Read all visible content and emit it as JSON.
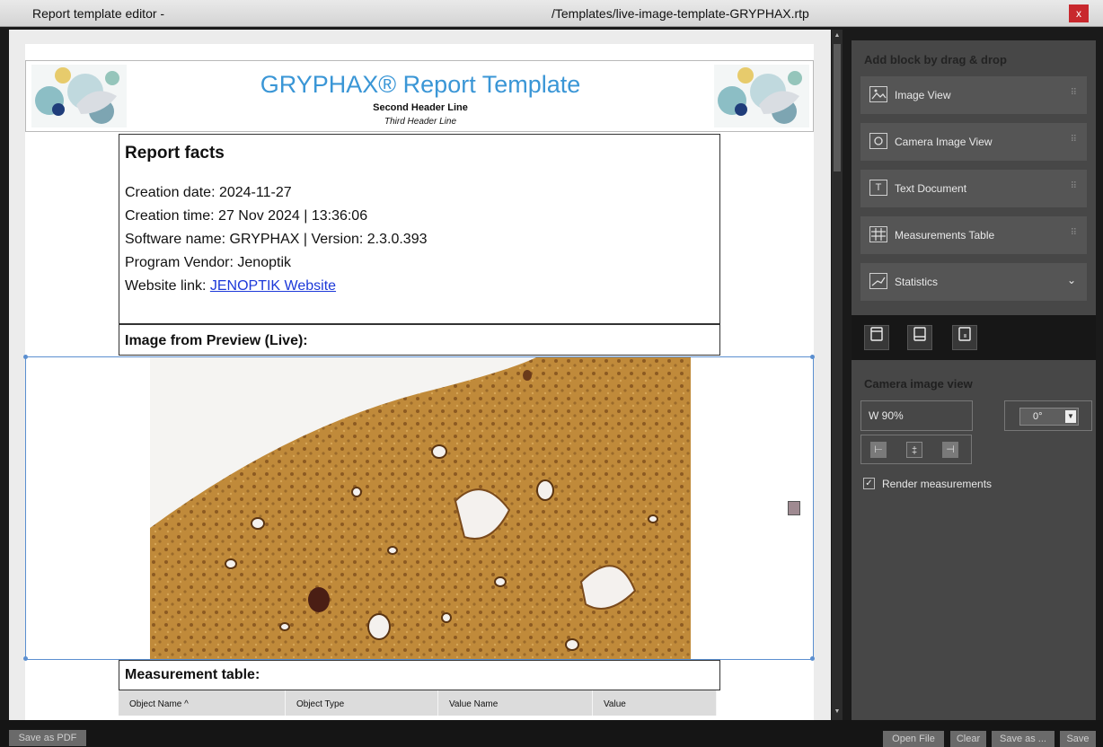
{
  "window": {
    "title_left": "Report template editor -",
    "title_right": "/Templates/live-image-template-GRYPHAX.rtp",
    "close_label": "x"
  },
  "report": {
    "header": {
      "title": "GRYPHAX® Report Template",
      "second_line": "Second Header Line",
      "third_line": "Third Header Line"
    },
    "facts": {
      "title": "Report facts",
      "creation_date": "Creation date: 2024-11-27",
      "creation_time": "Creation time: 27 Nov 2024  | 13:36:06",
      "software": "Software name: GRYPHAX | Version: 2.3.0.393",
      "vendor": "Program Vendor: Jenoptik",
      "website_prefix": "Website link: ",
      "website_link": "JENOPTIK Website"
    },
    "preview_title": "Image from Preview (Live):",
    "measurement_title": "Measurement table:",
    "table_columns": [
      "Object Name ^",
      "Object Type",
      "Value Name",
      "Value"
    ]
  },
  "panel": {
    "title": "Add block by drag & drop",
    "blocks": [
      {
        "label": "Image View",
        "icon": "image-icon"
      },
      {
        "label": "Camera Image View",
        "icon": "camera-icon"
      },
      {
        "label": "Text Document",
        "icon": "text-icon"
      },
      {
        "label": "Measurements Table",
        "icon": "table-icon"
      },
      {
        "label": "Statistics",
        "icon": "chart-icon"
      }
    ],
    "camera_view": {
      "title": "Camera image view",
      "width": "W   90%",
      "rotation": "0°",
      "render_label": "Render measurements",
      "render_checked": true
    }
  },
  "bottom": {
    "save_pdf": "Save as PDF",
    "open_file": "Open File",
    "clear": "Clear",
    "save_as": "Save as ...",
    "save": "Save"
  },
  "colors": {
    "accent_title": "#3a96d6",
    "link": "#1d39d9",
    "close": "#c8282d",
    "selection": "#5b8fd0"
  }
}
